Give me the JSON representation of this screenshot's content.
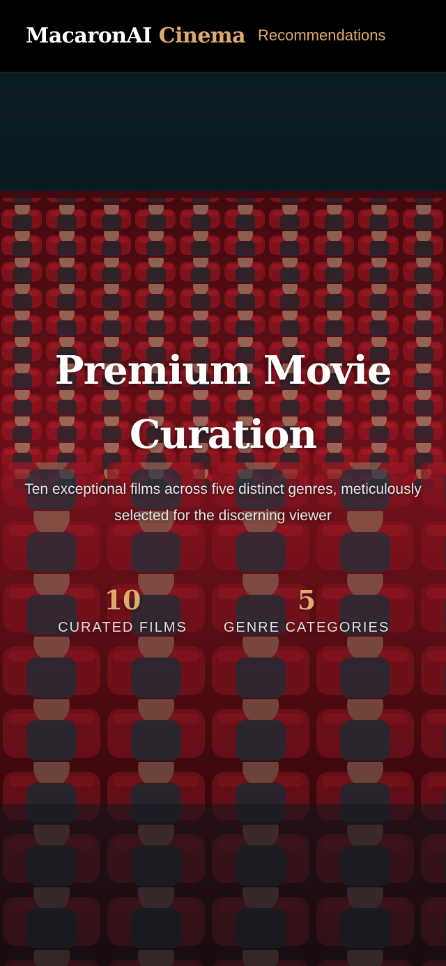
{
  "navbar": {
    "brand_main": "MacaronAI",
    "brand_accent": "Cinema",
    "link_recommendations": "Recommendations"
  },
  "hero": {
    "title": "Premium Movie Curation",
    "subtitle": "Ten exceptional films across five distinct genres, meticulously selected for the discerning viewer",
    "background_image": "theater-audience-photo"
  },
  "stats": [
    {
      "number": "10",
      "label": "CURATED FILMS"
    },
    {
      "number": "5",
      "label": "GENRE CATEGORIES"
    }
  ],
  "colors": {
    "accent": "#e0aa6e",
    "navbar_bg": "#000000",
    "text": "#ffffff"
  }
}
